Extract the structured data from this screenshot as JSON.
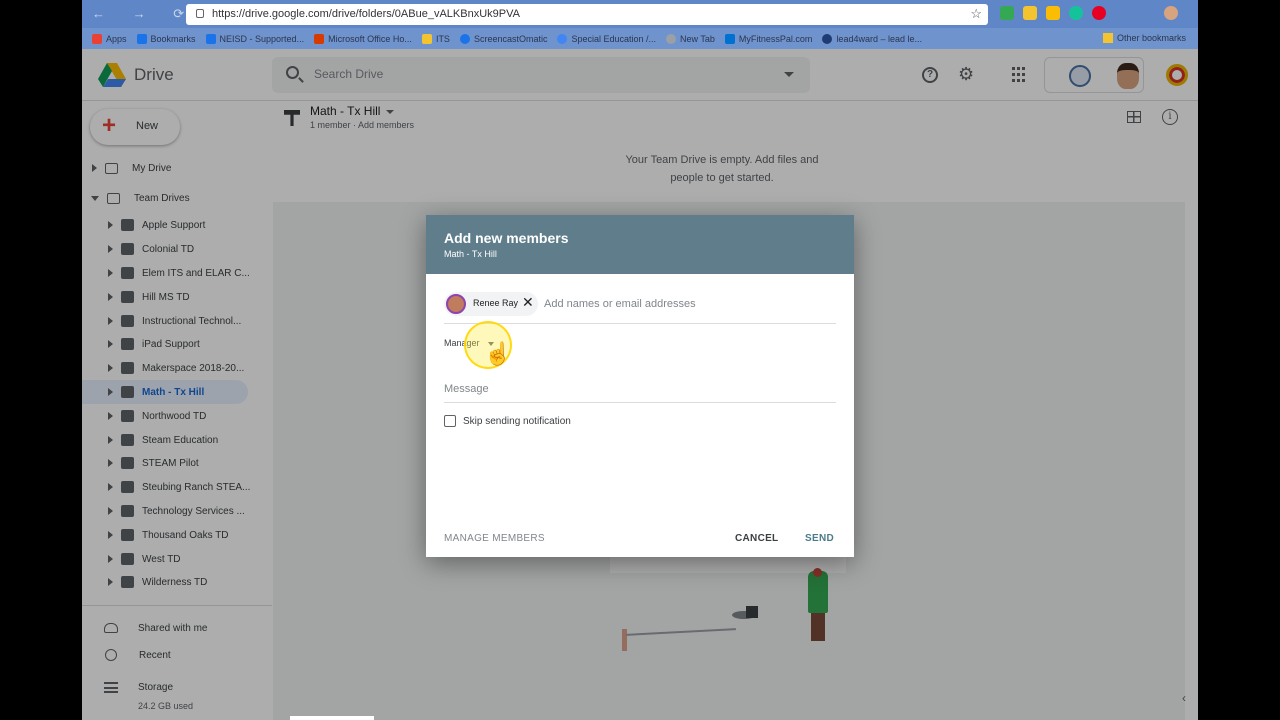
{
  "browser": {
    "url": "https://drive.google.com/drive/folders/0ABue_vALKBnxUk9PVA",
    "bookmarks": [
      {
        "label": "Apps",
        "color": "#e94235"
      },
      {
        "label": "Bookmarks",
        "color": "#1a73e8"
      },
      {
        "label": "NEISD - Supported...",
        "color": "#1a73e8"
      },
      {
        "label": "Microsoft Office Ho...",
        "color": "#d83b01"
      },
      {
        "label": "ITS",
        "color": "#f4c430"
      },
      {
        "label": "ScreencastOmatic",
        "color": "#1a73e8"
      },
      {
        "label": "Special Education /...",
        "color": "#4285f4"
      },
      {
        "label": "New Tab",
        "color": "#9aa0a6"
      },
      {
        "label": "MyFitnessPal.com",
        "color": "#0070d1"
      },
      {
        "label": "lead4ward – lead le...",
        "color": "#1f3b73"
      }
    ],
    "other_bookmarks": "Other bookmarks"
  },
  "app": {
    "name": "Drive",
    "search_placeholder": "Search Drive",
    "new_label": "New"
  },
  "sidebar": {
    "my_drive": "My Drive",
    "team_drives": "Team Drives",
    "drives": [
      "Apple Support",
      "Colonial TD",
      "Elem ITS and ELAR C...",
      "Hill MS TD",
      "Instructional Technol...",
      "iPad Support",
      "Makerspace 2018-20...",
      "Math - Tx Hill",
      "Northwood TD",
      "Steam Education",
      "STEAM Pilot",
      "Steubing Ranch STEA...",
      "Technology Services ...",
      "Thousand Oaks TD",
      "West TD",
      "Wilderness TD"
    ],
    "active_drive": "Math - Tx Hill",
    "shared": "Shared with me",
    "recent": "Recent",
    "storage": "Storage",
    "storage_used": "24.2 GB used"
  },
  "main": {
    "drive_title": "Math - Tx Hill",
    "members_line": "1 member · Add members",
    "empty_line1": "Your Team Drive is empty. Add files and",
    "empty_line2": "people to get started."
  },
  "dialog": {
    "title": "Add new members",
    "subtitle": "Math - Tx Hill",
    "chip_name": "Renee Ray",
    "add_placeholder": "Add names or email addresses",
    "role": "Manager",
    "message_placeholder": "Message",
    "skip_label": "Skip sending notification",
    "manage_members": "MANAGE MEMBERS",
    "cancel": "CANCEL",
    "send": "SEND"
  }
}
